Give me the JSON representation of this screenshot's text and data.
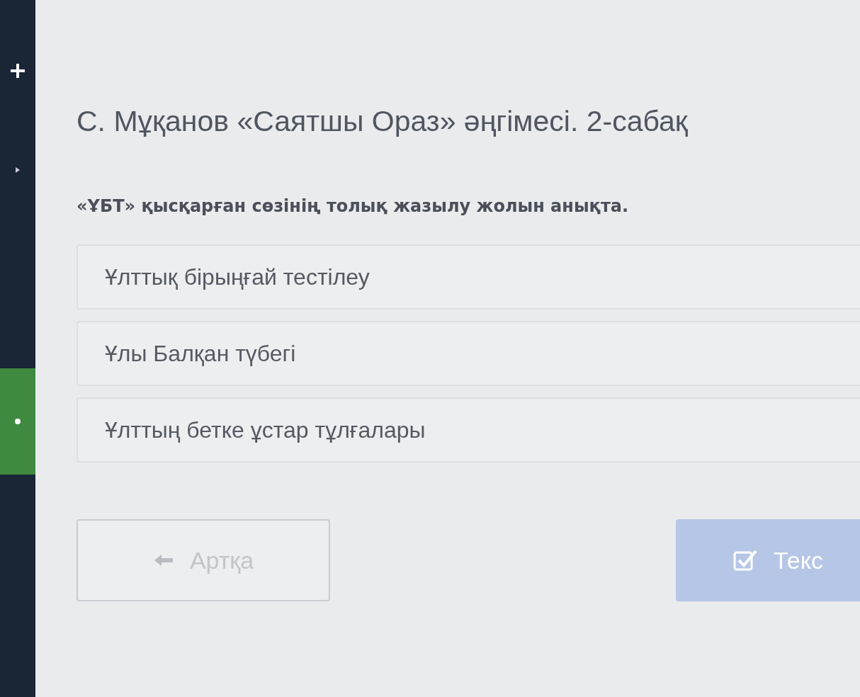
{
  "sidebar": {
    "items": [
      {
        "selected": false
      },
      {
        "selected": false
      },
      {
        "selected": true
      }
    ]
  },
  "title": "С. Мұқанов «Саятшы Ораз» әңгімесі. 2-сабақ",
  "question": "«ҰБТ» қысқарған сөзінің толық жазылу жолын анықта.",
  "options": [
    {
      "label": "Ұлттық бірыңғай тестілеу",
      "selected": false
    },
    {
      "label": "Ұлы Балқан түбегі",
      "selected": false
    },
    {
      "label": "Ұлттың бетке ұстар тұлғалары",
      "selected": false
    }
  ],
  "buttons": [
    {
      "kind": "back",
      "label": "Артқа",
      "disabled": true
    },
    {
      "kind": "check",
      "label": "Текс",
      "disabled": true
    }
  ]
}
